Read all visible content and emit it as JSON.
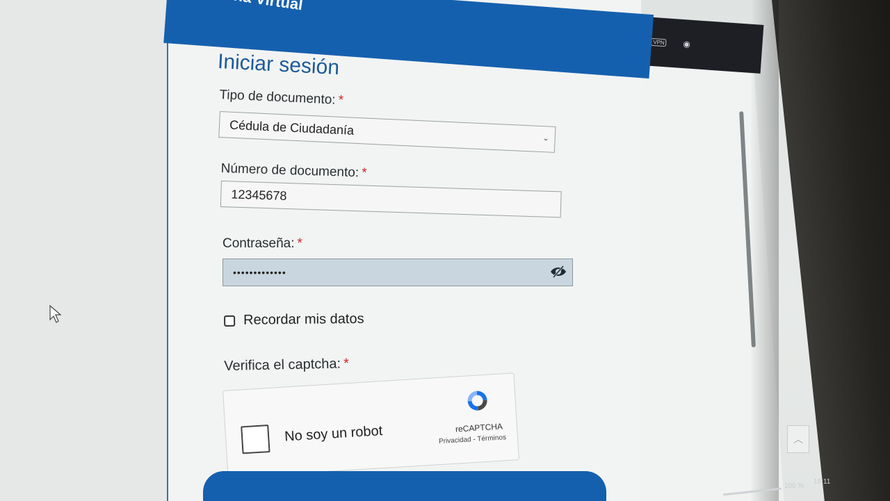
{
  "header": {
    "title": "Oficina Virtual"
  },
  "form": {
    "title": "Iniciar sesión",
    "required_mark": "*",
    "doc_type": {
      "label": "Tipo de documento:",
      "value": "Cédula de Ciudadanía"
    },
    "doc_number": {
      "label": "Número de documento:",
      "value": "12345678"
    },
    "password": {
      "label": "Contraseña:",
      "value": "•••••••••••••"
    },
    "remember": {
      "label": "Recordar mis datos",
      "checked": false
    },
    "captcha": {
      "label": "Verifica el captcha:",
      "checkbox_label": "No soy un robot",
      "brand": "reCAPTCHA",
      "links": "Privacidad - Términos"
    }
  },
  "status": {
    "zoom": "100 %",
    "time": "18:11"
  },
  "colors": {
    "brand_blue": "#1560ae",
    "title_blue": "#1d5b99",
    "required_red": "#d0222d"
  }
}
